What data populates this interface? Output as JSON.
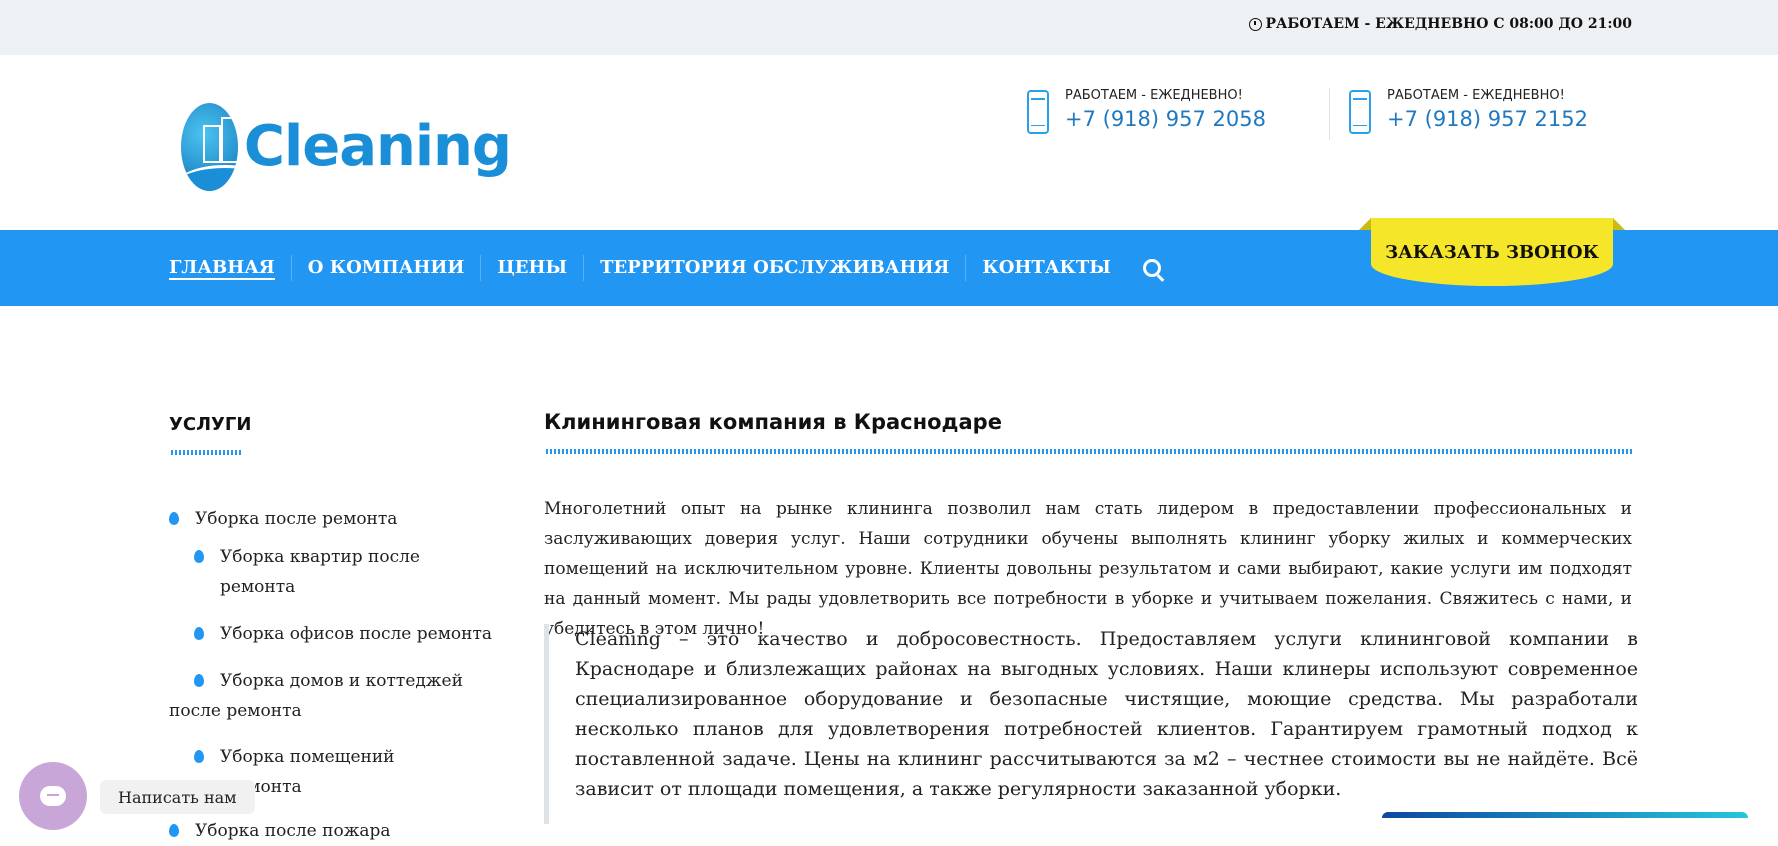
{
  "topbar": {
    "hours": "РАБОТАЕМ - ЕЖЕДНЕВНО С 08:00 ДО 21:00"
  },
  "logo": {
    "text": "Cleaning"
  },
  "phones": [
    {
      "caption": "РАБОТАЕМ - ЕЖЕДНЕВНО!",
      "number": "+7 (918) 957 2058"
    },
    {
      "caption": "РАБОТАЕМ - ЕЖЕДНЕВНО!",
      "number": "+7 (918) 957 2152"
    }
  ],
  "nav": {
    "items": [
      "ГЛАВНАЯ",
      "О КОМПАНИИ",
      "ЦЕНЫ",
      "ТЕРРИТОРИЯ ОБСЛУЖИВАНИЯ",
      "КОНТАКТЫ"
    ],
    "active": "ГЛАВНАЯ"
  },
  "callback": {
    "label": "ЗАКАЗАТЬ ЗВОНОК"
  },
  "sidebar": {
    "title": "УСЛУГИ",
    "items": [
      "Уборка после ремонта",
      "Уборка квартир после ремонта",
      "Уборка офисов после ремонта",
      "Уборка домов и коттеджей после ремонта",
      "Уборка помещений после ремонта",
      "Уборка после пожара"
    ]
  },
  "main": {
    "title": "Клининговая компания в Краснодаре",
    "intro": "Многолетний опыт на рынке клининга позволил нам стать лидером в предоставлении профессиональных и заслуживающих доверия услуг. Наши сотрудники обучены выполнять клининг уборку жилых и коммерческих помещений на исключительном уровне. Клиенты довольны результатом и сами выбирают, какие услуги им подходят на данный момент. Мы рады удовлетворить все потребности в уборке и учитываем пожелания. Свяжитесь с нами, и убедитесь в этом лично!",
    "quote": "Cleaning – это качество и добросовестность. Предоставляем услуги клининговой компании в Краснодаре и близлежащих районах на выгодных условиях. Наши клинеры используют современное специализированное оборудование и безопасные чистящие, моющие средства. Мы разработали несколько планов для удовлетворения потребностей клиентов. Гарантируем грамотный подход к поставленной задаче. Цены на клининг рассчитываются за м2 – честнее стоимости вы не найдёте. Всё зависит от площади помещения, а также регулярности заказанной уборки."
  },
  "chat": {
    "label": "Написать нам"
  },
  "colors": {
    "brand_blue": "#2196f3",
    "accent_yellow": "#f5e62a",
    "phone_blue": "#1f78c0"
  }
}
